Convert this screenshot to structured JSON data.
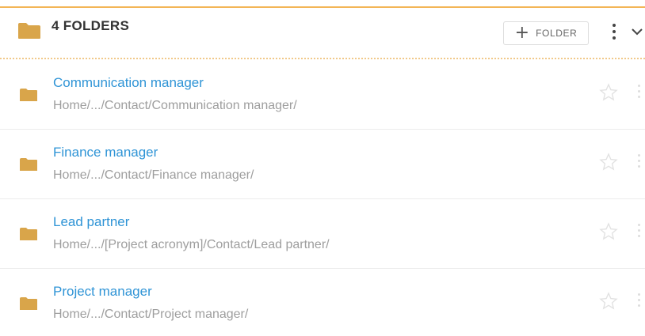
{
  "header": {
    "title": "4 FOLDERS",
    "add_button": {
      "icon": "plus-icon",
      "label": "FOLDER"
    },
    "menu_icon": "vertical-dots-icon",
    "toggle_icon": "chevron-down-icon"
  },
  "colors": {
    "accent": "#f3b556",
    "folder": "#d9a54a",
    "link": "#2f94d6",
    "path": "#9e9e9e"
  },
  "folders": [
    {
      "name": "Communication manager",
      "path": "Home/.../Contact/Communication manager/"
    },
    {
      "name": "Finance manager",
      "path": "Home/.../Contact/Finance manager/"
    },
    {
      "name": "Lead partner",
      "path": "Home/.../[Project acronym]/Contact/Lead partner/"
    },
    {
      "name": "Project manager",
      "path": "Home/.../Contact/Project manager/"
    }
  ]
}
